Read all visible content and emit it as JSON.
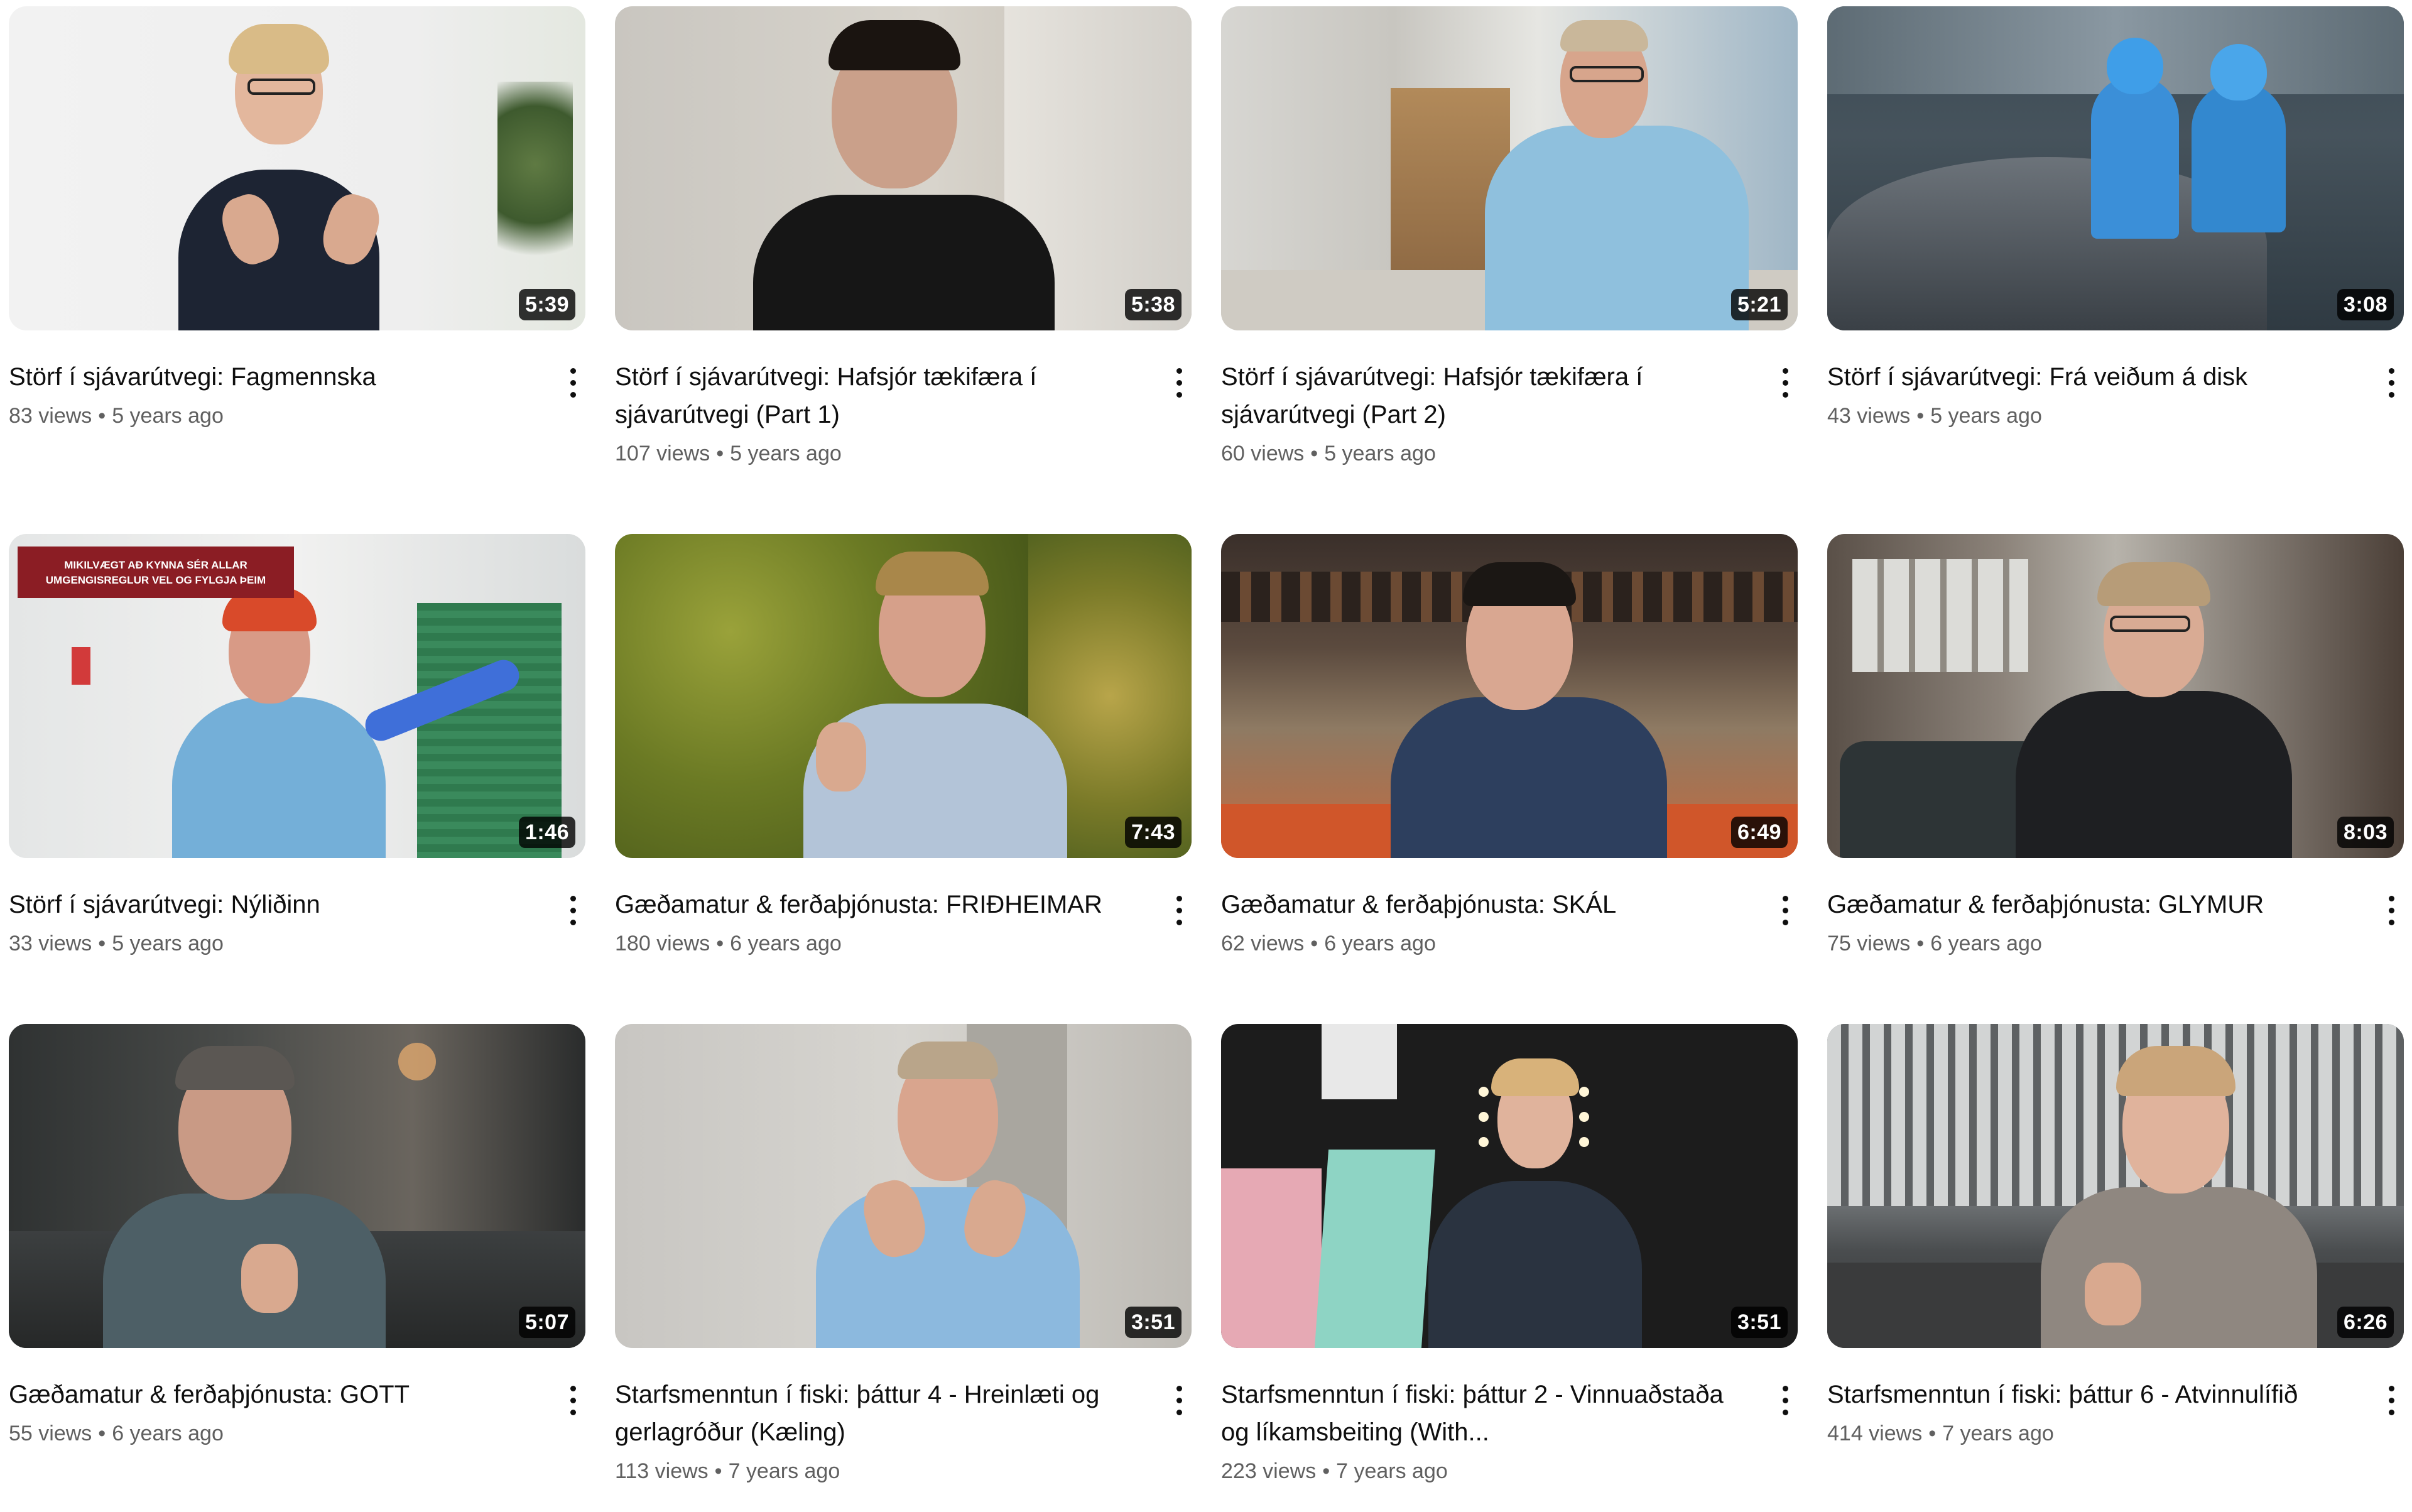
{
  "videos": [
    {
      "title": "Störf í sjávarútvegi: Fagmennska",
      "views": "83 views",
      "age": "5 years ago",
      "duration": "5:39"
    },
    {
      "title": "Störf í sjávarútvegi: Hafsjór tækifæra í sjávarútvegi (Part 1)",
      "views": "107 views",
      "age": "5 years ago",
      "duration": "5:38"
    },
    {
      "title": "Störf í sjávarútvegi: Hafsjór tækifæra í sjávarútvegi (Part 2)",
      "views": "60 views",
      "age": "5 years ago",
      "duration": "5:21"
    },
    {
      "title": "Störf í sjávarútvegi: Frá veiðum á disk",
      "views": "43 views",
      "age": "5 years ago",
      "duration": "3:08"
    },
    {
      "title": "Störf í sjávarútvegi: Nýliðinn",
      "views": "33 views",
      "age": "5 years ago",
      "duration": "1:46",
      "thumb_banner": "MIKILVÆGT AÐ KYNNA SÉR ALLAR UMGENGISREGLUR VEL OG FYLGJA ÞEIM"
    },
    {
      "title": "Gæðamatur & ferðaþjónusta: FRIÐHEIMAR",
      "views": "180 views",
      "age": "6 years ago",
      "duration": "7:43"
    },
    {
      "title": "Gæðamatur & ferðaþjónusta: SKÁL",
      "views": "62 views",
      "age": "6 years ago",
      "duration": "6:49"
    },
    {
      "title": "Gæðamatur & ferðaþjónusta: GLYMUR",
      "views": "75 views",
      "age": "6 years ago",
      "duration": "8:03"
    },
    {
      "title": "Gæðamatur & ferðaþjónusta: GOTT",
      "views": "55 views",
      "age": "6 years ago",
      "duration": "5:07"
    },
    {
      "title": "Starfsmenntun í fiski: þáttur 4 - Hreinlæti og gerlagróður (Kæling)",
      "views": "113 views",
      "age": "7 years ago",
      "duration": "3:51"
    },
    {
      "title": "Starfsmenntun í fiski: þáttur 2 - Vinnuaðstaða og líkamsbeiting (With...",
      "views": "223 views",
      "age": "7 years ago",
      "duration": "3:51"
    },
    {
      "title": "Starfsmenntun í fiski: þáttur 6 - Atvinnulífið",
      "views": "414 views",
      "age": "7 years ago",
      "duration": "6:26"
    }
  ],
  "separator": "•",
  "colors": {
    "title_text": "#0f0f0f",
    "meta_text": "#606060",
    "duration_badge_bg": "#000000cc"
  },
  "icons": {
    "more": "more-vert-icon"
  }
}
